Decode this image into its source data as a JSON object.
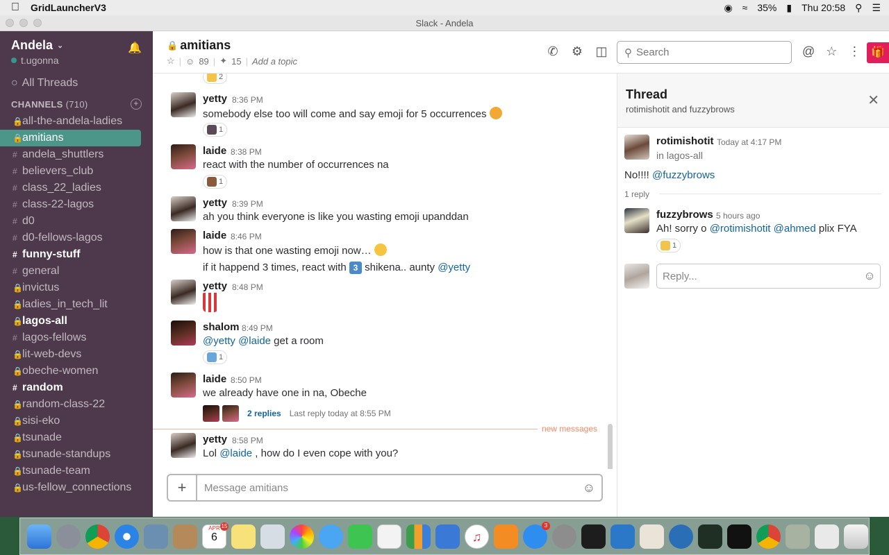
{
  "menubar": {
    "app_name": "GridLauncherV3",
    "battery": "35%",
    "clock": "Thu 20:58"
  },
  "window": {
    "title": "Slack - Andela"
  },
  "sidebar": {
    "team_name": "Andela",
    "user": "t.ugonna",
    "all_threads": "All Threads",
    "channels_label": "CHANNELS",
    "channels_count": "(710)",
    "channels": [
      {
        "name": "all-the-andela-ladies",
        "sym": "lock"
      },
      {
        "name": "amitians",
        "sym": "lock"
      },
      {
        "name": "andela_shuttlers",
        "sym": "#"
      },
      {
        "name": "believers_club",
        "sym": "#"
      },
      {
        "name": "class_22_ladies",
        "sym": "#"
      },
      {
        "name": "class-22-lagos",
        "sym": "#"
      },
      {
        "name": "d0",
        "sym": "#"
      },
      {
        "name": "d0-fellows-lagos",
        "sym": "#"
      },
      {
        "name": "funny-stuff",
        "sym": "#"
      },
      {
        "name": "general",
        "sym": "#"
      },
      {
        "name": "invictus",
        "sym": "lock"
      },
      {
        "name": "ladies_in_tech_lit",
        "sym": "lock"
      },
      {
        "name": "lagos-all",
        "sym": "lock"
      },
      {
        "name": "lagos-fellows",
        "sym": "#"
      },
      {
        "name": "lit-web-devs",
        "sym": "lock"
      },
      {
        "name": "obeche-women",
        "sym": "lock"
      },
      {
        "name": "random",
        "sym": "#"
      },
      {
        "name": "random-class-22",
        "sym": "lock"
      },
      {
        "name": "sisi-eko",
        "sym": "lock"
      },
      {
        "name": "tsunade",
        "sym": "lock"
      },
      {
        "name": "tsunade-standups",
        "sym": "lock"
      },
      {
        "name": "tsunade-team",
        "sym": "lock"
      },
      {
        "name": "us-fellow_connections",
        "sym": "lock"
      }
    ]
  },
  "channel": {
    "name": "amitians",
    "members": "89",
    "pinned": "15",
    "topic": "Add a topic"
  },
  "search": {
    "placeholder": "Search"
  },
  "messages": [
    {
      "author": "",
      "time": "",
      "text": ""
    },
    {
      "author": "yetty",
      "time": "8:36 PM",
      "text": "somebody else too will come and say emoji for 5 occurrences"
    },
    {
      "author": "laide",
      "time": "8:38 PM",
      "text": "react with the number of occurrences na"
    },
    {
      "author": "yetty",
      "time": "8:39 PM",
      "text": "ah you think everyone is like you wasting emoji upanddan"
    },
    {
      "author": "laide",
      "time": "8:46 PM",
      "text": "how is that one wasting emoji now…",
      "text2_a": "if it happend 3 times, react with",
      "text2_b": "shikena.. aunty",
      "mention": "@yetty"
    },
    {
      "author": "yetty",
      "time": "8:48 PM"
    },
    {
      "author": "shalom",
      "time": "8:49 PM",
      "mention1": "@yetty",
      "mention2": "@laide",
      "text": "get a room"
    },
    {
      "author": "laide",
      "time": "8:50 PM",
      "text": "we already have one in na, Obeche",
      "replies": "2 replies",
      "last_reply": "Last reply today at 8:55 PM"
    },
    {
      "author": "yetty",
      "time": "8:58 PM",
      "text_a": "Lol",
      "mention": "@laide",
      "text_b": ", how do I even cope with you?"
    }
  ],
  "reactions": [
    "2",
    "1",
    "1",
    "1"
  ],
  "keycap": "3",
  "new_messages_label": "new messages",
  "composer": {
    "placeholder": "Message amitians"
  },
  "thread": {
    "title": "Thread",
    "participants": "rotimishotit and fuzzybrows",
    "parent": {
      "author": "rotimishotit",
      "time": "Today at 4:17 PM",
      "in_channel": "in lagos-all",
      "text": "No!!!!",
      "mention": "@fuzzybrows"
    },
    "reply_count": "1 reply",
    "reply": {
      "author": "fuzzybrows",
      "time": "5 hours ago",
      "text_a": "Ah! sorry o",
      "mention1": "@rotimishotit",
      "mention2": "@ahmed",
      "text_b": "plix FYA",
      "reaction_count": "1"
    },
    "reply_placeholder": "Reply..."
  },
  "dock": {
    "calendar_month": "APR",
    "calendar_day": "6",
    "badges": [
      "15",
      "3"
    ]
  },
  "colors": {
    "sidebar_bg": "#4d394b",
    "active_channel": "#4c9689",
    "mention": "#1264a3",
    "new_messages": "#f08a67",
    "gift": "#e01e5a"
  }
}
